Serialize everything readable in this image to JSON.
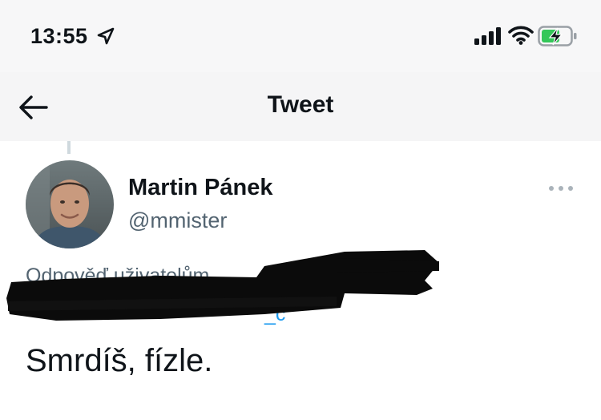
{
  "status_bar": {
    "time": "13:55",
    "location_icon": "location-arrow-icon",
    "signal_icon": "cellular-signal-icon",
    "wifi_icon": "wifi-icon",
    "battery_icon": "battery-charging-icon"
  },
  "nav": {
    "back_icon": "back-arrow-icon",
    "title": "Tweet"
  },
  "tweet": {
    "author_name": "Martin Pánek",
    "author_handle": "@mmister",
    "reply_prefix": "Odpověď uživatelům",
    "reply_trailing": ",",
    "reply_line2_tail": "_c",
    "text": "Smrdíš, fízle.",
    "more_icon": "more-horizontal-icon"
  },
  "colors": {
    "accent": "#1d9bf0",
    "secondary_text": "#536471",
    "battery_green": "#34c759"
  }
}
